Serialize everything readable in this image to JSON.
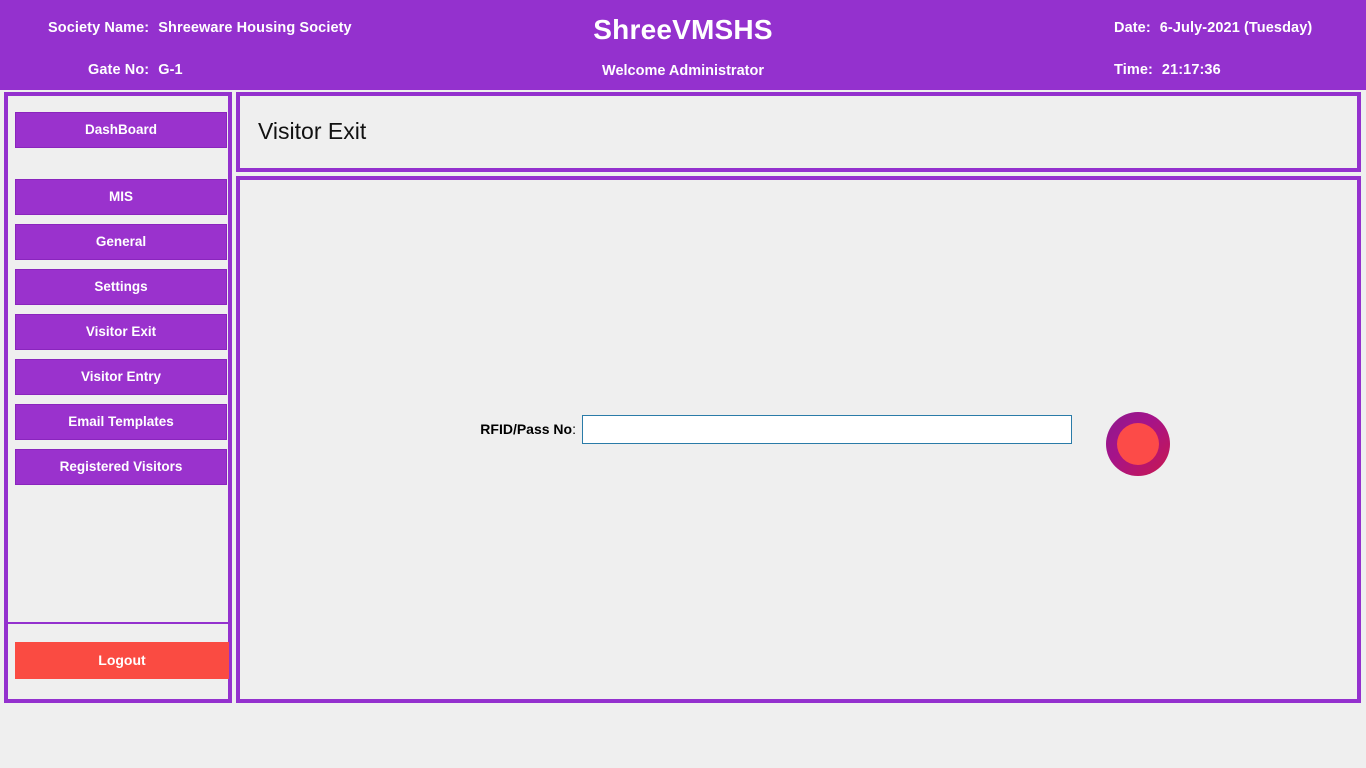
{
  "header": {
    "society_label": "Society Name:",
    "society_value": "Shreeware Housing Society",
    "gate_label": "Gate No:",
    "gate_value": "G-1",
    "brand_title": "ShreeVMSHS",
    "welcome_text": "Welcome Administrator",
    "date_label": "Date:",
    "date_value": "6-July-2021 (Tuesday)",
    "time_label": "Time:",
    "time_value": "21:17:36",
    "background_color": "#9431ce",
    "text_color": "#ffffff"
  },
  "sidebar": {
    "items": [
      {
        "label": "DashBoard",
        "name": "dashboard"
      },
      {
        "label": "MIS",
        "name": "mis"
      },
      {
        "label": "General",
        "name": "general"
      },
      {
        "label": "Settings",
        "name": "settings"
      },
      {
        "label": "Visitor Exit",
        "name": "visitor-exit"
      },
      {
        "label": "Visitor Entry",
        "name": "visitor-entry"
      },
      {
        "label": "Email Templates",
        "name": "email-templates"
      },
      {
        "label": "Registered Visitors",
        "name": "registered-visitors"
      }
    ],
    "logout_label": "Logout",
    "button_color": "#9a32cd",
    "logout_color": "#fa4b42",
    "border_color": "#9431ce"
  },
  "main": {
    "page_title": "Visitor Exit",
    "form": {
      "rfid_label": "RFID/Pass No",
      "rfid_label_colon": ":",
      "rfid_value": "",
      "rfid_placeholder": ""
    },
    "status_indicator": {
      "icon": "status-circle-icon",
      "ring_color_start": "#8c1a8f",
      "ring_color_end": "#c9174f",
      "inner_color": "#fc4b48"
    },
    "background_color": "#efefef"
  }
}
